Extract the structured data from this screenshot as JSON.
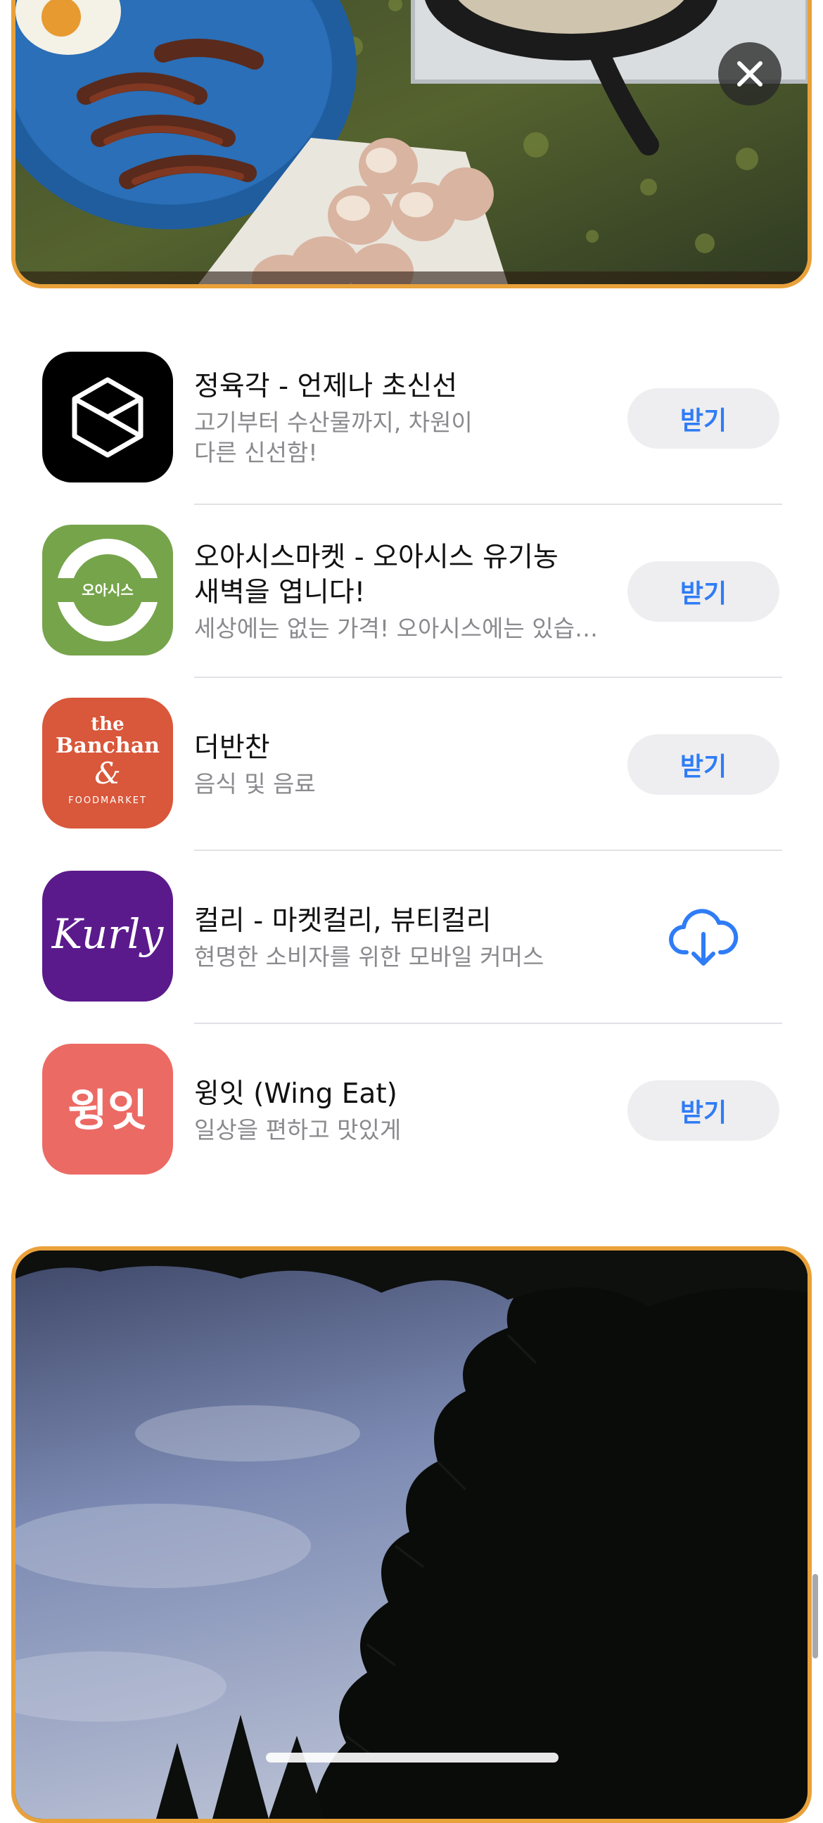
{
  "apps": [
    {
      "name": "정육각 - 언제나 초신선",
      "subtitle": "고기부터 수산물까지, 차원이\n다른 신선함!",
      "action": "받기",
      "icon": "jeongyukgak-logo-icon",
      "icon_bg": "#000000"
    },
    {
      "name": "오아시스마켓 - 오아시스 유기농\n새벽을 엽니다!",
      "subtitle": "세상에는 없는 가격! 오아시스에는 있습…",
      "action": "받기",
      "icon": "oasis-ring-icon",
      "icon_bg": "#76A44B",
      "icon_text": "오아시스"
    },
    {
      "name": "더반찬",
      "subtitle": "음식 및 음료",
      "action": "받기",
      "icon": "thebanchan-logo-icon",
      "icon_bg": "#D9573A",
      "icon_text_1": "the",
      "icon_text_2": "Banchan",
      "icon_text_3": "&",
      "icon_text_4": "FOODMARKET"
    },
    {
      "name": "컬리 - 마켓컬리, 뷰티컬리",
      "subtitle": "현명한 소비자를 위한 모바일 커머스",
      "action": "download",
      "icon": "kurly-logo-icon",
      "icon_bg": "#5A1A8C",
      "icon_text": "Kurly"
    },
    {
      "name": "윙잇 (Wing Eat)",
      "subtitle": "일상을 편하고 맛있게",
      "action": "받기",
      "icon": "wingeat-logo-icon",
      "icon_bg": "#EC6A64",
      "icon_text": "윙잇"
    }
  ],
  "colors": {
    "accent": "#2F7CF6",
    "card_border": "#E9A13A"
  }
}
